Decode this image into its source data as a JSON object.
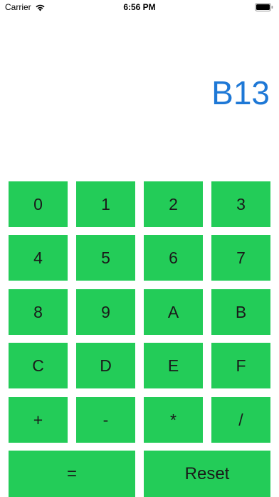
{
  "status_bar": {
    "carrier": "Carrier",
    "time": "6:56 PM"
  },
  "display": {
    "value": "B13",
    "color": "#1e78d6"
  },
  "keypad": {
    "accent_color": "#23cc58",
    "keys": [
      "0",
      "1",
      "2",
      "3",
      "4",
      "5",
      "6",
      "7",
      "8",
      "9",
      "A",
      "B",
      "C",
      "D",
      "E",
      "F",
      "+",
      "-",
      "*",
      "/"
    ],
    "equals_label": "=",
    "reset_label": "Reset"
  }
}
